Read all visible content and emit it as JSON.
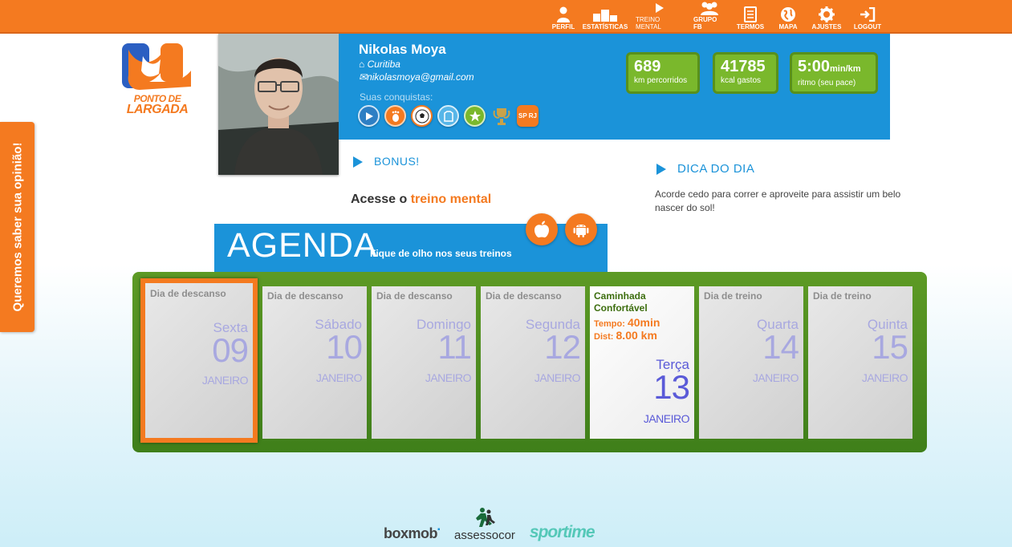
{
  "nav": [
    {
      "label": "PERFIL",
      "icon": "user-icon"
    },
    {
      "label": "ESTATÍSTICAS",
      "icon": "podium-icon"
    },
    {
      "label": "TREINO MENTAL",
      "icon": "play-icon"
    },
    {
      "label": "GRUPO FB",
      "icon": "group-icon"
    },
    {
      "label": "TERMOS",
      "icon": "document-icon"
    },
    {
      "label": "MAPA",
      "icon": "globe-icon"
    },
    {
      "label": "AJUSTES",
      "icon": "gear-icon"
    },
    {
      "label": "LOGOUT",
      "icon": "logout-icon"
    }
  ],
  "logo": {
    "line1": "PONTO DE",
    "line2": "LARGADA"
  },
  "feedback": "Queremos saber sua opinião!",
  "profile": {
    "name": "Nikolas Moya",
    "city": "Curitiba",
    "email": "nikolasmoya@gmail.com",
    "conquests_label": "Suas conquistas:",
    "badges": [
      "play-badge",
      "footprint-badge",
      "soccer-badge",
      "shirt-badge",
      "star-badge",
      "trophy-badge",
      "sp-rj-badge"
    ],
    "badge_text": {
      "sprj": "SP RJ"
    }
  },
  "stats": {
    "km": {
      "value": "689",
      "label": "km percorridos"
    },
    "kcal": {
      "value": "41785",
      "label": "kcal gastos"
    },
    "pace": {
      "value": "5:00",
      "unit": "min/km",
      "label": "ritmo (seu pace)"
    }
  },
  "bonus": {
    "title": "BONUS!"
  },
  "mental": {
    "prefix": "Acesse o",
    "link": "treino mental"
  },
  "tip": {
    "title": "DICA DO DIA",
    "text": "Acorde cedo para correr e aproveite para assistir um belo nascer do sol!"
  },
  "agenda": {
    "title": "AGENDA",
    "subtitle": "Fique de olho nos seus treinos"
  },
  "days": [
    {
      "label": "Dia de descanso",
      "weekday": "Sexta",
      "day": "09",
      "month": "JANEIRO"
    },
    {
      "label": "Dia de descanso",
      "weekday": "Sábado",
      "day": "10",
      "month": "JANEIRO"
    },
    {
      "label": "Dia de descanso",
      "weekday": "Domingo",
      "day": "11",
      "month": "JANEIRO"
    },
    {
      "label": "Dia de descanso",
      "weekday": "Segunda",
      "day": "12",
      "month": "JANEIRO"
    },
    {
      "label": "Caminhada Confortável",
      "time_label": "Tempo:",
      "time": "40min",
      "dist_label": "Dist:",
      "dist": "8.00 km",
      "weekday": "Terça",
      "day": "13",
      "month": "JANEIRO"
    },
    {
      "label": "Dia de treino",
      "weekday": "Quarta",
      "day": "14",
      "month": "JANEIRO"
    },
    {
      "label": "Dia de treino",
      "weekday": "Quinta",
      "day": "15",
      "month": "JANEIRO"
    }
  ],
  "partners": {
    "boxmob": "boxmob",
    "assessocor": "assessocor",
    "sportime": "sportime"
  },
  "colors": {
    "orange": "#f47a20",
    "blue": "#1b93d9",
    "green": "#7ab82c"
  }
}
